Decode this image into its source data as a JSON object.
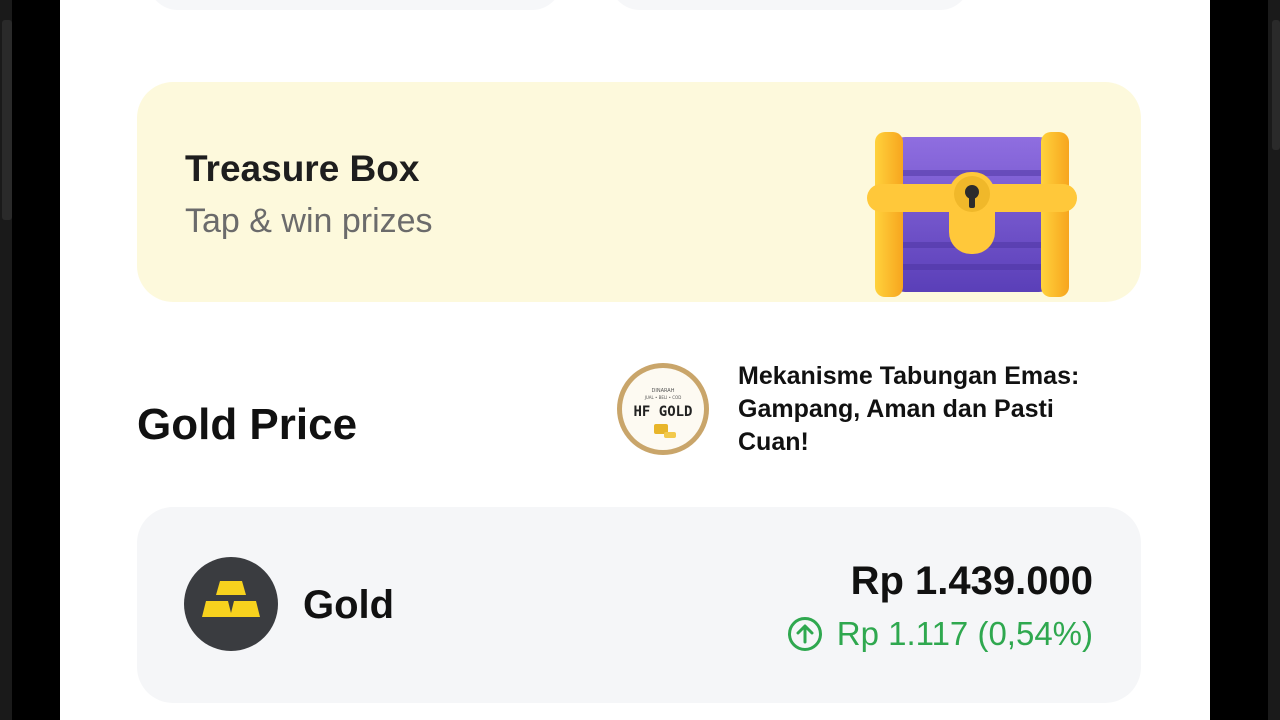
{
  "treasure": {
    "title": "Treasure Box",
    "subtitle": "Tap & win prizes",
    "icon": "treasure-chest-icon"
  },
  "gold_price": {
    "heading": "Gold Price"
  },
  "article": {
    "thumb_text_small": "DINARAH",
    "thumb_text_tiny": "JUAL • BELI • COD",
    "thumb_logo": "HF GOLD",
    "title": "Mekanisme Tabungan Emas: Gampang, Aman dan Pasti Cuan!"
  },
  "gold": {
    "name": "Gold",
    "price": "Rp 1.439.000",
    "change": "Rp 1.117 (0,54%)",
    "change_icon": "arrow-up-circle-icon",
    "icon": "gold-bars-icon"
  },
  "colors": {
    "treasure_bg": "#fdf9dc",
    "card_bg": "#f5f6f8",
    "positive": "#2fa84f",
    "gold_icon_bg": "#3a3c40"
  }
}
